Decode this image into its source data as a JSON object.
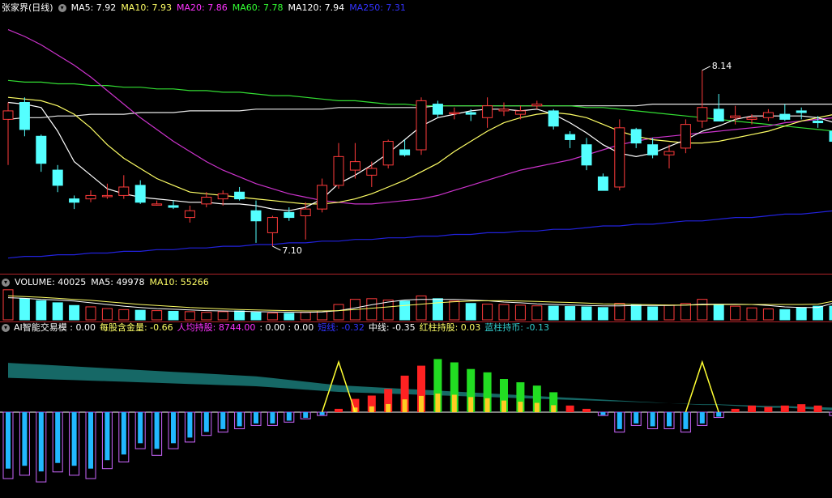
{
  "price_header": {
    "title": "张家界(日线)",
    "indicators": [
      {
        "label": "MA5: 7.92",
        "color": "#ffffff"
      },
      {
        "label": "MA10: 7.93",
        "color": "#ffff66"
      },
      {
        "label": "MA20: 7.86",
        "color": "#ff33ff"
      },
      {
        "label": "MA60: 7.78",
        "color": "#33ff33"
      },
      {
        "label": "MA120: 7.94",
        "color": "#ffffff"
      },
      {
        "label": "MA250: 7.31",
        "color": "#3333ff"
      }
    ]
  },
  "price_annotations": {
    "high": "8.14",
    "low": "7.10"
  },
  "volume_header": {
    "title": "VOLUME: 40025",
    "ma5": "MA5: 49978",
    "ma10": "MA10: 55266"
  },
  "indicator_header": {
    "items": [
      {
        "label": "AI智能交易模 : 0.00",
        "color": "#ffffff"
      },
      {
        "label": "每股含金量: -0.66",
        "color": "#ffff66"
      },
      {
        "label": "人均持股: 8744.00",
        "color": "#ff33ff"
      },
      {
        "label": ": 0.00 : 0.00",
        "color": "#ffffff"
      },
      {
        "label": "短线: -0.32",
        "color": "#3333ff"
      },
      {
        "label": "中线: -0.35",
        "color": "#ffffff"
      },
      {
        "label": "红柱持股: 0.03",
        "color": "#ffff66"
      },
      {
        "label": "蓝柱持币: -0.13",
        "color": "#33cccc"
      }
    ]
  },
  "colors": {
    "up": "#ff3b3b",
    "down": "#54ffff",
    "separator": "#b0232a",
    "ma250": "#2222dd"
  },
  "price_data": {
    "ymax": 8.45,
    "ymin": 7.0,
    "candles": [
      [
        7.85,
        7.95,
        7.58,
        7.9
      ],
      [
        7.95,
        7.98,
        7.75,
        7.79
      ],
      [
        7.75,
        7.76,
        7.54,
        7.59
      ],
      [
        7.55,
        7.58,
        7.42,
        7.46
      ],
      [
        7.38,
        7.4,
        7.32,
        7.36
      ],
      [
        7.38,
        7.43,
        7.36,
        7.4
      ],
      [
        7.4,
        7.47,
        7.38,
        7.4
      ],
      [
        7.4,
        7.52,
        7.38,
        7.45
      ],
      [
        7.46,
        7.49,
        7.35,
        7.36
      ],
      [
        7.35,
        7.37,
        7.34,
        7.35
      ],
      [
        7.34,
        7.37,
        7.32,
        7.33
      ],
      [
        7.27,
        7.34,
        7.24,
        7.31
      ],
      [
        7.35,
        7.42,
        7.33,
        7.39
      ],
      [
        7.38,
        7.43,
        7.34,
        7.41
      ],
      [
        7.42,
        7.45,
        7.37,
        7.38
      ],
      [
        7.31,
        7.37,
        7.12,
        7.25
      ],
      [
        7.18,
        7.28,
        7.1,
        7.27
      ],
      [
        7.3,
        7.33,
        7.25,
        7.27
      ],
      [
        7.28,
        7.36,
        7.14,
        7.32
      ],
      [
        7.32,
        7.5,
        7.3,
        7.46
      ],
      [
        7.46,
        7.71,
        7.44,
        7.63
      ],
      [
        7.55,
        7.71,
        7.5,
        7.6
      ],
      [
        7.52,
        7.6,
        7.45,
        7.56
      ],
      [
        7.58,
        7.73,
        7.56,
        7.72
      ],
      [
        7.67,
        7.73,
        7.63,
        7.64
      ],
      [
        7.67,
        7.98,
        7.64,
        7.96
      ],
      [
        7.94,
        7.96,
        7.86,
        7.88
      ],
      [
        7.89,
        7.92,
        7.85,
        7.89
      ],
      [
        7.89,
        7.91,
        7.84,
        7.88
      ],
      [
        7.86,
        7.98,
        7.8,
        7.93
      ],
      [
        7.9,
        7.95,
        7.87,
        7.91
      ],
      [
        7.88,
        7.93,
        7.85,
        7.9
      ],
      [
        7.93,
        7.96,
        7.91,
        7.94
      ],
      [
        7.9,
        7.91,
        7.79,
        7.81
      ],
      [
        7.76,
        7.78,
        7.68,
        7.73
      ],
      [
        7.7,
        7.74,
        7.55,
        7.58
      ],
      [
        7.51,
        7.53,
        7.43,
        7.43
      ],
      [
        7.45,
        7.85,
        7.43,
        7.8
      ],
      [
        7.79,
        7.8,
        7.68,
        7.71
      ],
      [
        7.7,
        7.74,
        7.62,
        7.64
      ],
      [
        7.64,
        7.7,
        7.56,
        7.66
      ],
      [
        7.68,
        7.85,
        7.65,
        7.82
      ],
      [
        7.84,
        8.14,
        7.8,
        7.92
      ],
      [
        7.91,
        8.0,
        7.86,
        7.84
      ],
      [
        7.86,
        7.93,
        7.82,
        7.87
      ],
      [
        7.85,
        7.88,
        7.82,
        7.86
      ],
      [
        7.86,
        7.91,
        7.84,
        7.89
      ],
      [
        7.88,
        7.94,
        7.84,
        7.85
      ],
      [
        7.9,
        7.92,
        7.85,
        7.89
      ],
      [
        7.84,
        7.87,
        7.8,
        7.83
      ],
      [
        7.78,
        7.82,
        7.71,
        7.72
      ]
    ],
    "ma5": [
      7.95,
      7.94,
      7.92,
      7.78,
      7.6,
      7.52,
      7.44,
      7.41,
      7.39,
      7.38,
      7.37,
      7.36,
      7.36,
      7.35,
      7.35,
      7.34,
      7.32,
      7.31,
      7.33,
      7.38,
      7.47,
      7.52,
      7.58,
      7.65,
      7.73,
      7.81,
      7.86,
      7.88,
      7.9,
      7.91,
      7.91,
      7.9,
      7.91,
      7.88,
      7.83,
      7.77,
      7.7,
      7.65,
      7.63,
      7.65,
      7.69,
      7.73,
      7.78,
      7.81,
      7.85,
      7.87,
      7.87,
      7.87,
      7.87,
      7.86,
      7.83
    ],
    "ma10": [
      7.98,
      7.97,
      7.96,
      7.93,
      7.88,
      7.8,
      7.7,
      7.62,
      7.56,
      7.5,
      7.46,
      7.42,
      7.41,
      7.4,
      7.39,
      7.38,
      7.37,
      7.36,
      7.35,
      7.35,
      7.36,
      7.38,
      7.41,
      7.45,
      7.49,
      7.54,
      7.59,
      7.66,
      7.72,
      7.78,
      7.83,
      7.86,
      7.88,
      7.89,
      7.88,
      7.86,
      7.82,
      7.78,
      7.75,
      7.73,
      7.72,
      7.71,
      7.71,
      7.72,
      7.74,
      7.76,
      7.78,
      7.81,
      7.84,
      7.86,
      7.88
    ],
    "ma20": [
      8.38,
      8.34,
      8.29,
      8.23,
      8.17,
      8.1,
      8.02,
      7.94,
      7.86,
      7.79,
      7.72,
      7.66,
      7.6,
      7.55,
      7.51,
      7.47,
      7.44,
      7.41,
      7.39,
      7.37,
      7.36,
      7.35,
      7.35,
      7.36,
      7.37,
      7.38,
      7.4,
      7.43,
      7.46,
      7.49,
      7.52,
      7.55,
      7.57,
      7.59,
      7.61,
      7.64,
      7.67,
      7.7,
      7.72,
      7.74,
      7.75,
      7.76,
      7.77,
      7.78,
      7.79,
      7.8,
      7.81,
      7.83,
      7.84,
      7.85,
      7.86
    ],
    "ma60": [
      8.08,
      8.07,
      8.07,
      8.06,
      8.06,
      8.05,
      8.05,
      8.04,
      8.04,
      8.03,
      8.03,
      8.02,
      8.02,
      8.01,
      8.01,
      8.0,
      7.99,
      7.99,
      7.98,
      7.97,
      7.96,
      7.96,
      7.95,
      7.94,
      7.94,
      7.93,
      7.93,
      7.93,
      7.93,
      7.93,
      7.93,
      7.93,
      7.93,
      7.93,
      7.93,
      7.92,
      7.92,
      7.91,
      7.9,
      7.89,
      7.88,
      7.87,
      7.86,
      7.85,
      7.84,
      7.83,
      7.82,
      7.81,
      7.8,
      7.79,
      7.78
    ],
    "ma120": [
      7.85,
      7.86,
      7.86,
      7.87,
      7.87,
      7.88,
      7.88,
      7.88,
      7.89,
      7.89,
      7.89,
      7.9,
      7.9,
      7.9,
      7.9,
      7.91,
      7.91,
      7.91,
      7.91,
      7.91,
      7.92,
      7.92,
      7.92,
      7.92,
      7.92,
      7.92,
      7.93,
      7.93,
      7.93,
      7.93,
      7.93,
      7.93,
      7.93,
      7.93,
      7.93,
      7.93,
      7.93,
      7.93,
      7.93,
      7.94,
      7.94,
      7.94,
      7.94,
      7.94,
      7.94,
      7.94,
      7.94,
      7.94,
      7.94,
      7.94,
      7.94
    ],
    "ma250": [
      7.03,
      7.04,
      7.04,
      7.05,
      7.05,
      7.06,
      7.06,
      7.07,
      7.07,
      7.08,
      7.08,
      7.09,
      7.09,
      7.1,
      7.1,
      7.11,
      7.11,
      7.12,
      7.12,
      7.13,
      7.13,
      7.14,
      7.14,
      7.15,
      7.15,
      7.16,
      7.16,
      7.17,
      7.17,
      7.18,
      7.18,
      7.19,
      7.19,
      7.2,
      7.2,
      7.21,
      7.22,
      7.22,
      7.23,
      7.23,
      7.24,
      7.25,
      7.25,
      7.26,
      7.27,
      7.27,
      7.28,
      7.29,
      7.29,
      7.3,
      7.31
    ]
  },
  "volume_data": {
    "ymax": 90000,
    "bars": [
      88000,
      62000,
      56000,
      50000,
      42000,
      38000,
      33000,
      30000,
      28000,
      27000,
      25000,
      24000,
      22000,
      24000,
      26000,
      22000,
      20000,
      19000,
      22000,
      26000,
      45000,
      60000,
      62000,
      58000,
      55000,
      70000,
      62000,
      55000,
      48000,
      46000,
      45000,
      43000,
      41000,
      40000,
      39000,
      38000,
      36000,
      48000,
      44000,
      38000,
      43000,
      48000,
      60000,
      45000,
      40000,
      35000,
      32000,
      30000,
      36000,
      40000,
      40025
    ],
    "ma5": [
      65000,
      63000,
      60000,
      58000,
      55000,
      50000,
      45000,
      40000,
      36000,
      33000,
      31000,
      29000,
      27000,
      26000,
      25000,
      24000,
      23000,
      22500,
      22000,
      23000,
      27000,
      35000,
      44000,
      52000,
      58000,
      60000,
      60000,
      60000,
      58000,
      56000,
      52000,
      50000,
      47000,
      45000,
      43000,
      42000,
      41000,
      41000,
      42000,
      42000,
      42000,
      43000,
      46000,
      46000,
      46000,
      45000,
      42000,
      38000,
      36000,
      36000,
      49978
    ],
    "ma10": [
      70000,
      68000,
      66000,
      63000,
      60000,
      57000,
      53000,
      49000,
      45000,
      42000,
      39000,
      36000,
      34000,
      32000,
      30000,
      29000,
      28000,
      27000,
      26000,
      26000,
      27000,
      30000,
      34000,
      38000,
      42000,
      46000,
      50000,
      53000,
      55000,
      56000,
      56000,
      55000,
      54000,
      52000,
      51000,
      49000,
      47000,
      46000,
      45000,
      44000,
      43000,
      43000,
      44000,
      45000,
      45000,
      45000,
      45000,
      45000,
      45000,
      46000,
      55266
    ]
  },
  "indicator_data": {
    "bars": [
      -1.0,
      -0.95,
      -1.05,
      -0.9,
      -0.95,
      -1.0,
      -0.85,
      -0.75,
      -0.55,
      -0.65,
      -0.55,
      -0.45,
      -0.35,
      -0.3,
      -0.25,
      -0.2,
      -0.2,
      -0.15,
      -0.1,
      -0.05,
      0.05,
      0.2,
      0.25,
      0.35,
      0.55,
      0.7,
      0.8,
      0.75,
      0.65,
      0.6,
      0.5,
      0.45,
      0.4,
      0.3,
      0.1,
      0.05,
      -0.05,
      -0.3,
      -0.2,
      -0.25,
      -0.25,
      -0.3,
      -0.2,
      -0.08,
      0.05,
      0.1,
      0.08,
      0.1,
      0.12,
      0.1,
      -0.05
    ],
    "cyan_level": [
      0.55,
      0.54,
      0.53,
      0.52,
      0.51,
      0.5,
      0.49,
      0.48,
      0.47,
      0.46,
      0.45,
      0.44,
      0.43,
      0.42,
      0.41,
      0.4,
      0.38,
      0.36,
      0.34,
      0.32,
      0.3,
      0.29,
      0.28,
      0.27,
      0.26,
      0.25,
      0.24,
      0.23,
      0.22,
      0.21,
      0.2,
      0.19,
      0.18,
      0.17,
      0.16,
      0.15,
      0.14,
      0.13,
      0.12,
      0.11,
      0.1,
      0.09,
      0.08,
      0.08,
      0.07,
      0.06,
      0.05,
      0.05,
      0.04,
      0.03,
      0.02
    ]
  }
}
